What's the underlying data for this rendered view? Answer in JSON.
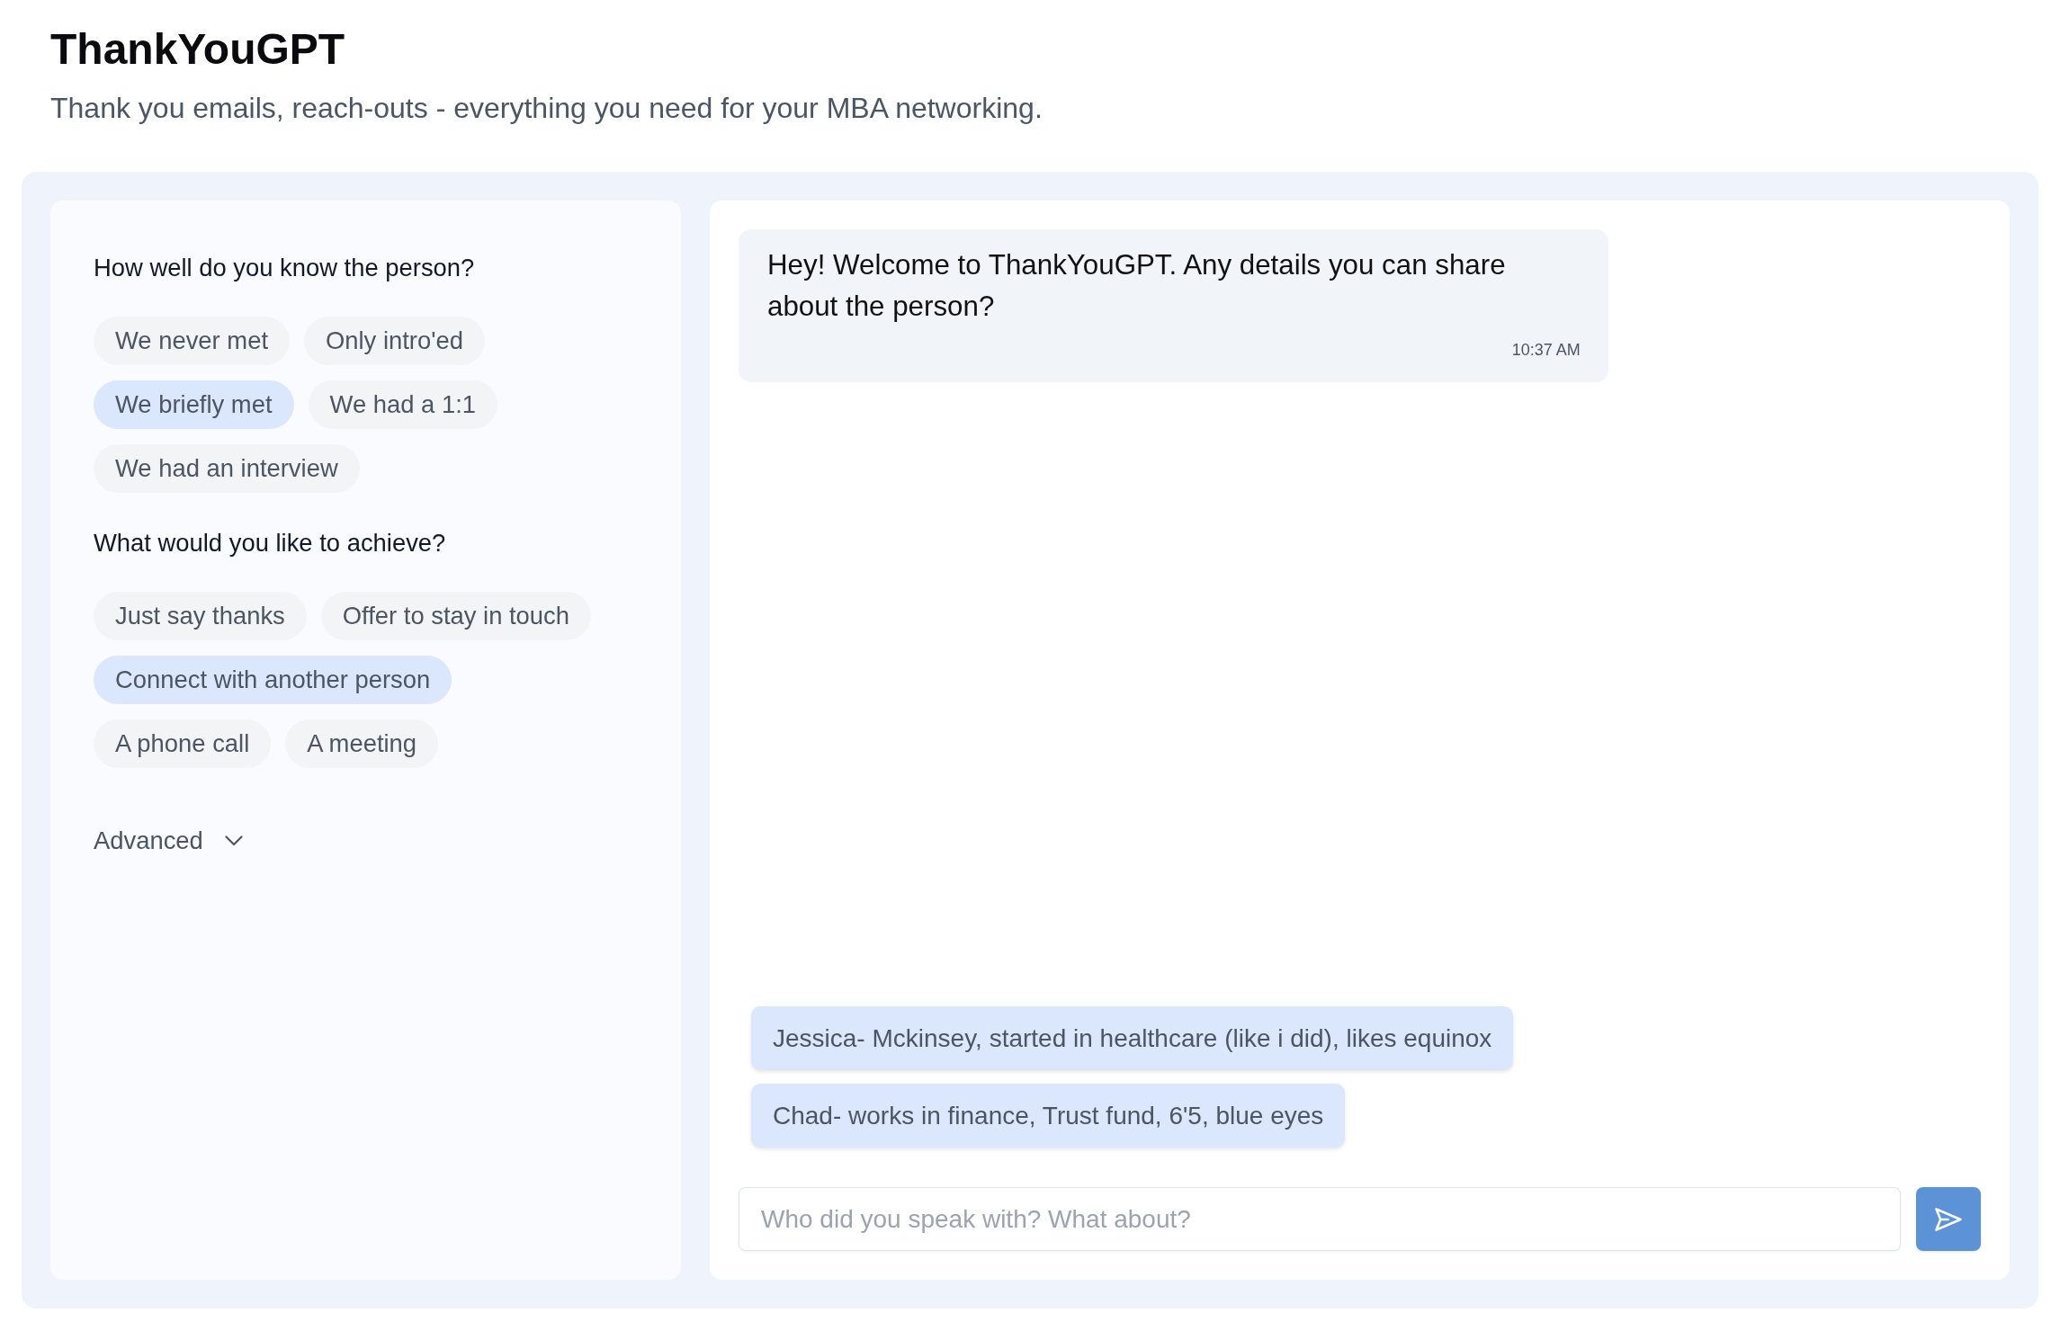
{
  "header": {
    "title": "ThankYouGPT",
    "subtitle": "Thank you emails, reach-outs - everything you need for your MBA networking."
  },
  "options_panel": {
    "groups": [
      {
        "question": "How well do you know the person?",
        "options": [
          {
            "label": "We never met",
            "selected": false
          },
          {
            "label": "Only intro'ed",
            "selected": false
          },
          {
            "label": "We briefly met",
            "selected": true
          },
          {
            "label": "We had a 1:1",
            "selected": false
          },
          {
            "label": "We had an interview",
            "selected": false
          }
        ]
      },
      {
        "question": "What would you like to achieve?",
        "options": [
          {
            "label": "Just say thanks",
            "selected": false
          },
          {
            "label": "Offer to stay in touch",
            "selected": false
          },
          {
            "label": "Connect with another person",
            "selected": true
          },
          {
            "label": "A phone call",
            "selected": false
          },
          {
            "label": "A meeting",
            "selected": false
          }
        ]
      }
    ],
    "advanced": {
      "label": "Advanced",
      "expanded": false
    }
  },
  "chat": {
    "messages": [
      {
        "text": "Hey! Welcome to ThankYouGPT. Any details you can share about the person?",
        "time": "10:37 AM"
      }
    ],
    "suggestions": [
      "Jessica- Mckinsey, started in healthcare (like i did), likes equinox",
      "Chad- works in finance, Trust fund, 6'5, blue eyes"
    ],
    "input": {
      "placeholder": "Who did you speak with? What about?"
    }
  }
}
